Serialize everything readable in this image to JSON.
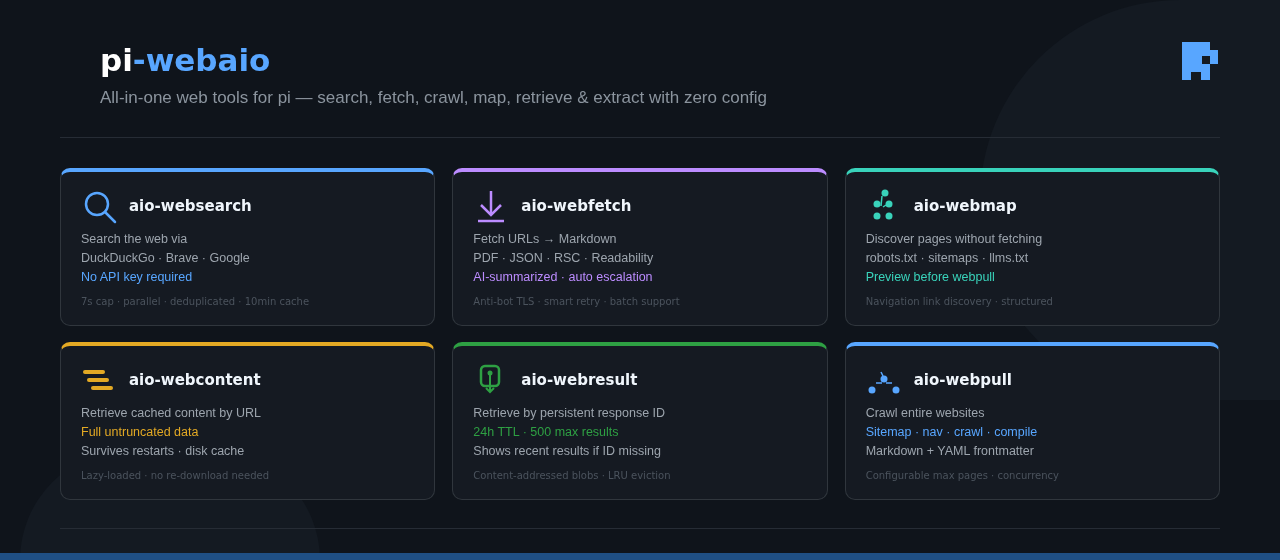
{
  "header": {
    "title": [
      {
        "text": "pi",
        "kind": "plain"
      },
      {
        "text": "-webaio",
        "kind": "accent"
      }
    ],
    "subtitle": "All-in-one web tools for pi — search, fetch, crawl, map, retrieve & extract with zero config"
  },
  "cards": [
    {
      "title": "aio-websearch",
      "kind": "search",
      "color": "#58a6ff",
      "lines": [
        {
          "text": "Search the web via",
          "kind": "plain"
        },
        {
          "text": "DuckDuckGo · Brave · Google",
          "kind": "plain"
        },
        {
          "text": "No API key required",
          "kind": "accent"
        }
      ],
      "note": "7s cap · parallel · deduplicated · 10min cache"
    },
    {
      "title": "aio-webfetch",
      "kind": "download",
      "color": "#bc8cff",
      "lines": [
        {
          "text": "Fetch URLs → Markdown",
          "kind": "plain"
        },
        {
          "text": "PDF · JSON · RSC · Readability",
          "kind": "plain"
        },
        {
          "text": "AI-summarized · auto escalation",
          "kind": "accent"
        }
      ],
      "note": "Anti-bot TLS · smart retry · batch support"
    },
    {
      "title": "aio-webmap",
      "kind": "nodes",
      "color": "#39d3bb",
      "lines": [
        {
          "text": "Discover pages without fetching",
          "kind": "plain"
        },
        {
          "text": "robots.txt · sitemaps · llms.txt",
          "kind": "plain"
        },
        {
          "text": "Preview before webpull",
          "kind": "accent"
        }
      ],
      "note": "Navigation link discovery · structured"
    },
    {
      "title": "aio-webcontent",
      "kind": "lines",
      "color": "#e3a924",
      "lines": [
        {
          "text": "Retrieve cached content by URL",
          "kind": "plain"
        },
        {
          "text": "Full untruncated data",
          "kind": "accent"
        },
        {
          "text": "Survives restarts · disk cache",
          "kind": "plain"
        }
      ],
      "note": "Lazy-loaded · no re-download needed"
    },
    {
      "title": "aio-webresult",
      "kind": "pin",
      "color": "#2ea043",
      "lines": [
        {
          "text": "Retrieve by persistent response ID",
          "kind": "plain"
        },
        {
          "text": "24h TTL · 500 max results",
          "kind": "accent"
        },
        {
          "text": "Shows recent results if ID missing",
          "kind": "plain"
        }
      ],
      "note": "Content-addressed blobs · LRU eviction"
    },
    {
      "title": "aio-webpull",
      "kind": "graph",
      "color": "#58a6ff",
      "lines": [
        {
          "text": "Crawl entire websites",
          "kind": "plain"
        },
        {
          "text": "Sitemap · nav · crawl · compile",
          "kind": "accent"
        },
        {
          "text": "Markdown + YAML frontmatter",
          "kind": "plain"
        }
      ],
      "note": "Configurable max pages · concurrency"
    }
  ]
}
